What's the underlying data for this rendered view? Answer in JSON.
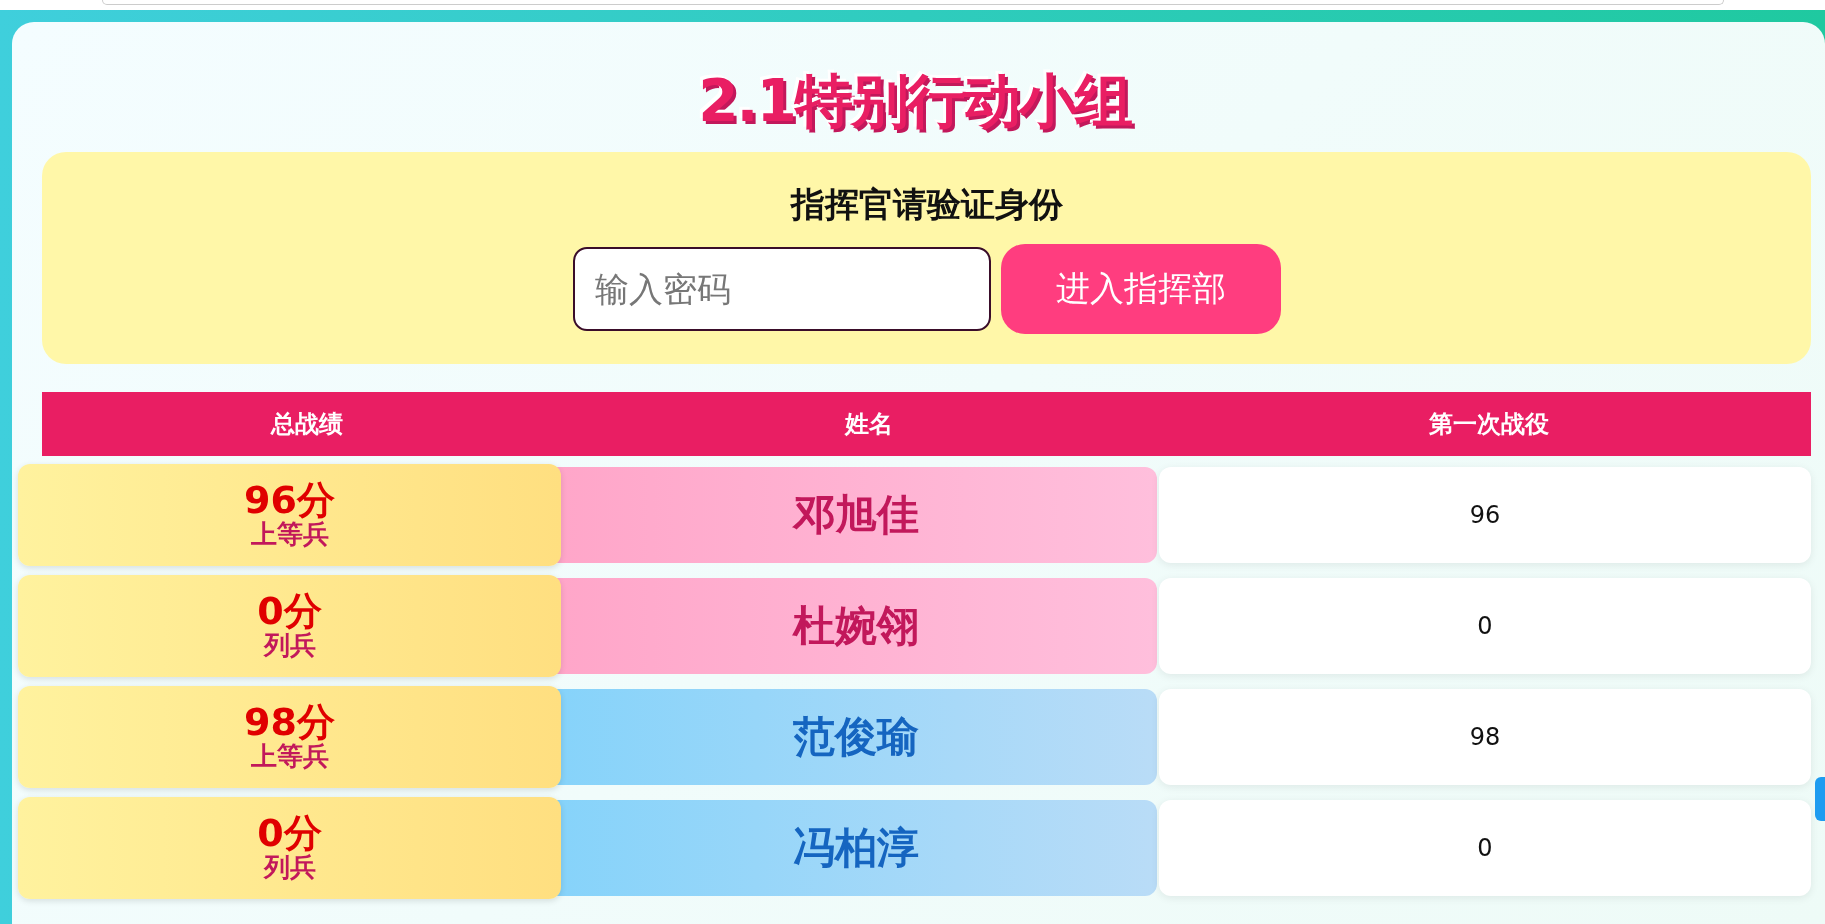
{
  "title": "2.1特别行动小组",
  "login": {
    "heading": "指挥官请验证身份",
    "placeholder": "输入密码",
    "button": "进入指挥部"
  },
  "table": {
    "columns": [
      "总战绩",
      "姓名",
      "第一次战役"
    ],
    "rows": [
      {
        "score": "96分",
        "rank": "上等兵",
        "name": "邓旭佳",
        "color": "#c2185b",
        "battle_1": "96"
      },
      {
        "score": "0分",
        "rank": "列兵",
        "name": "杜婉翎",
        "color": "#c2185b",
        "battle_1": "0"
      },
      {
        "score": "98分",
        "rank": "上等兵",
        "name": "范俊瑜",
        "color": "#1565c0",
        "battle_1": "98"
      },
      {
        "score": "0分",
        "rank": "列兵",
        "name": "冯柏淳",
        "color": "#1565c0",
        "battle_1": "0"
      }
    ]
  }
}
